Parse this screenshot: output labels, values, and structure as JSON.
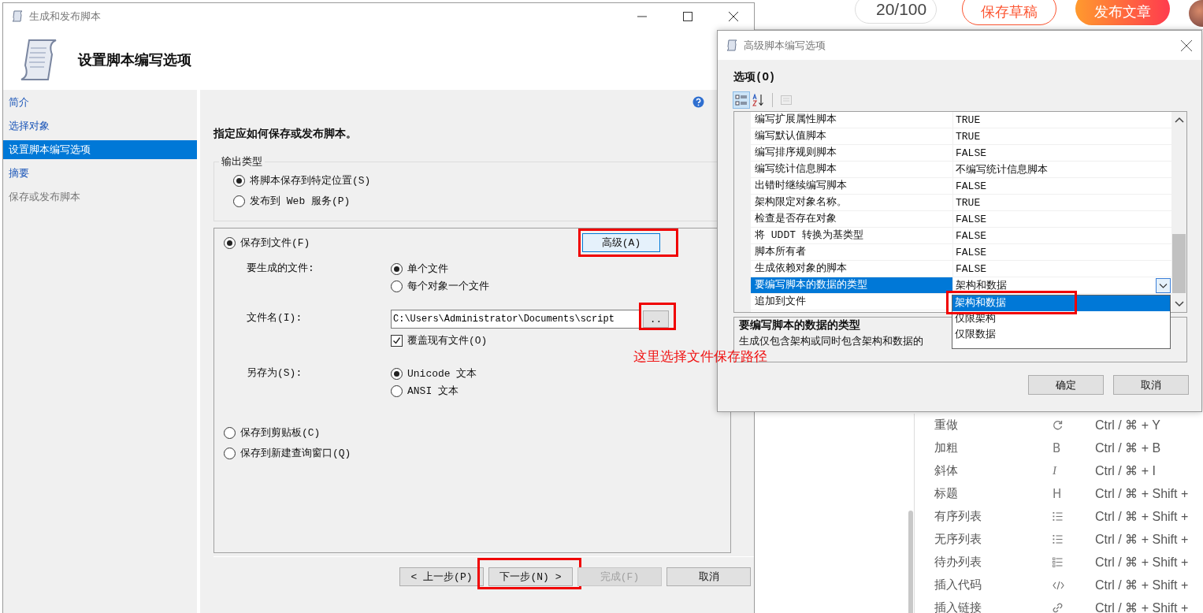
{
  "background_page": {
    "word_count": "20/100",
    "buttons": [
      {
        "label": "保存草稿",
        "kind": "outline"
      },
      {
        "label": "发布文章",
        "kind": "primary"
      }
    ],
    "shortcuts": [
      {
        "name": "重做",
        "kind": "redo",
        "keys": "Ctrl / ⌘ + Y"
      },
      {
        "name": "加粗",
        "kind": "letter",
        "glyph": "B",
        "keys": "Ctrl / ⌘ + B"
      },
      {
        "name": "斜体",
        "kind": "italic",
        "glyph": "I",
        "keys": "Ctrl / ⌘ + I"
      },
      {
        "name": "标题",
        "kind": "letter",
        "glyph": "H",
        "keys": "Ctrl / ⌘ + Shift +"
      },
      {
        "name": "有序列表",
        "kind": "list",
        "keys": "Ctrl / ⌘ + Shift +"
      },
      {
        "name": "无序列表",
        "kind": "list",
        "keys": "Ctrl / ⌘ + Shift +"
      },
      {
        "name": "待办列表",
        "kind": "todo",
        "keys": "Ctrl / ⌘ + Shift +"
      },
      {
        "name": "插入代码",
        "kind": "code",
        "keys": "Ctrl / ⌘ + Shift +"
      },
      {
        "name": "插入链接",
        "kind": "link",
        "keys": "Ctrl / ⌘ + Shift +"
      }
    ]
  },
  "wizard": {
    "title": "生成和发布脚本",
    "heading": "设置脚本编写选项",
    "nav": [
      {
        "label": "简介",
        "selected": false,
        "disabled": false
      },
      {
        "label": "选择对象",
        "selected": false,
        "disabled": false
      },
      {
        "label": "设置脚本编写选项",
        "selected": true,
        "disabled": false
      },
      {
        "label": "摘要",
        "selected": false,
        "disabled": false
      },
      {
        "label": "保存或发布脚本",
        "selected": false,
        "disabled": true
      }
    ],
    "instruction": "指定应如何保存或发布脚本。",
    "output_type": {
      "legend": "输出类型",
      "options": [
        {
          "label": "将脚本保存到特定位置(S)",
          "selected": true
        },
        {
          "label": "发布到 Web 服务(P)",
          "selected": false
        }
      ]
    },
    "save_to_file": {
      "label": "保存到文件(F)",
      "selected": true,
      "advanced_button": "高级(A)",
      "files_label": "要生成的文件:",
      "files_options": [
        {
          "label": "单个文件",
          "selected": true
        },
        {
          "label": "每个对象一个文件",
          "selected": false
        }
      ],
      "filename_label": "文件名(I):",
      "filename_value": "C:\\Users\\Administrator\\Documents\\script",
      "browse_button": "..",
      "overwrite": {
        "label": "覆盖现有文件(O)",
        "checked": true
      },
      "save_as_label": "另存为(S):",
      "save_as_options": [
        {
          "label": "Unicode 文本",
          "selected": true
        },
        {
          "label": "ANSI 文本",
          "selected": false
        }
      ]
    },
    "other_destinations": [
      {
        "label": "保存到剪贴板(C)",
        "selected": false
      },
      {
        "label": "保存到新建查询窗口(Q)",
        "selected": false
      }
    ],
    "buttons": [
      {
        "label": "< 上一步(P)",
        "disabled": false
      },
      {
        "label": "下一步(N) >",
        "disabled": false
      },
      {
        "label": "完成(F)",
        "disabled": true
      },
      {
        "label": "取消",
        "disabled": false
      }
    ]
  },
  "advanced_dialog": {
    "title": "高级脚本编写选项",
    "section_label": "选项(O)",
    "toolbar": [
      {
        "kind": "categorized",
        "selected": true,
        "disabled": false
      },
      {
        "kind": "alphabetical",
        "selected": false,
        "disabled": false
      },
      {
        "kind": "property-pages",
        "selected": false,
        "disabled": true
      }
    ],
    "properties": [
      {
        "name": "编写扩展属性脚本",
        "value": "TRUE",
        "selected": false
      },
      {
        "name": "编写默认值脚本",
        "value": "TRUE",
        "selected": false
      },
      {
        "name": "编写排序规则脚本",
        "value": "FALSE",
        "selected": false
      },
      {
        "name": "编写统计信息脚本",
        "value": "不编写统计信息脚本",
        "selected": false
      },
      {
        "name": "出错时继续编写脚本",
        "value": "FALSE",
        "selected": false
      },
      {
        "name": "架构限定对象名称。",
        "value": "TRUE",
        "selected": false
      },
      {
        "name": "检查是否存在对象",
        "value": "FALSE",
        "selected": false
      },
      {
        "name": "将 UDDT 转换为基类型",
        "value": "FALSE",
        "selected": false
      },
      {
        "name": "脚本所有者",
        "value": "FALSE",
        "selected": false
      },
      {
        "name": "生成依赖对象的脚本",
        "value": "FALSE",
        "selected": false
      },
      {
        "name": "要编写脚本的数据的类型",
        "value": "架构和数据",
        "selected": true
      },
      {
        "name": "追加到文件",
        "selected": false
      }
    ],
    "dropdown_options": [
      {
        "label": "架构和数据",
        "selected": true
      },
      {
        "label": "仅限架构",
        "selected": false
      },
      {
        "label": "仅限数据",
        "selected": false
      }
    ],
    "description": {
      "title": "要编写脚本的数据的类型",
      "text": "生成仅包含架构或同时包含架构和数据的"
    },
    "buttons": [
      "确定",
      "取消"
    ]
  },
  "annotation": "这里选择文件保存路径"
}
